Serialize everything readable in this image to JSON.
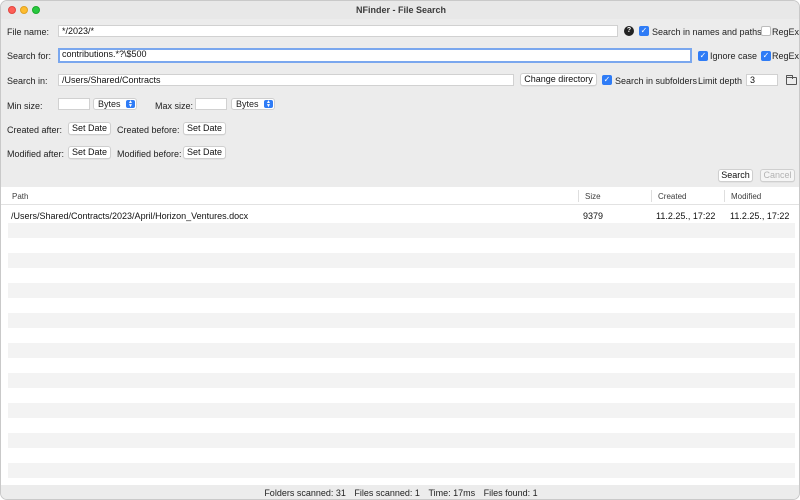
{
  "window": {
    "title": "NFinder - File Search"
  },
  "form": {
    "file_name_label": "File name:",
    "file_name_value": "*/2023/*",
    "help_glyph": "?",
    "search_names_paths_label": "Search in names and paths",
    "search_names_paths_checked": true,
    "regex1_label": "RegEx",
    "regex1_checked": false,
    "search_for_label": "Search for:",
    "search_for_value": "contributions.*?\\$500",
    "ignore_case_label": "Ignore case",
    "ignore_case_checked": true,
    "regex2_label": "RegEx",
    "regex2_checked": true,
    "search_in_label": "Search in:",
    "search_in_value": "/Users/Shared/Contracts",
    "change_directory_label": "Change directory",
    "search_subfolders_label": "Search in subfolders",
    "search_subfolders_checked": true,
    "limit_depth_label": "Limit depth",
    "limit_depth_value": "3",
    "min_size_label": "Min size:",
    "min_size_value": "",
    "min_size_unit": "Bytes",
    "max_size_label": "Max size:",
    "max_size_value": "",
    "max_size_unit": "Bytes",
    "created_after_label": "Created after:",
    "created_before_label": "Created before:",
    "modified_after_label": "Modified after:",
    "modified_before_label": "Modified before:",
    "set_date_label": "Set Date",
    "search_button_label": "Search",
    "cancel_button_label": "Cancel"
  },
  "table": {
    "columns": [
      "Path",
      "Size",
      "Created",
      "Modified"
    ],
    "rows": [
      {
        "path": "/Users/Shared/Contracts/2023/April/Horizon_Ventures.docx",
        "size": "9379",
        "created": "11.2.25., 17:22",
        "modified": "11.2.25., 17:22"
      }
    ]
  },
  "status": {
    "folders_scanned": "Folders scanned: 31",
    "files_scanned": "Files scanned: 1",
    "time": "Time: 17ms",
    "files_found": "Files found: 1"
  },
  "colors": {
    "accent": "#2f7cf6",
    "focus_ring": "#7aa7ee",
    "stripe": "#f3f3f3"
  }
}
